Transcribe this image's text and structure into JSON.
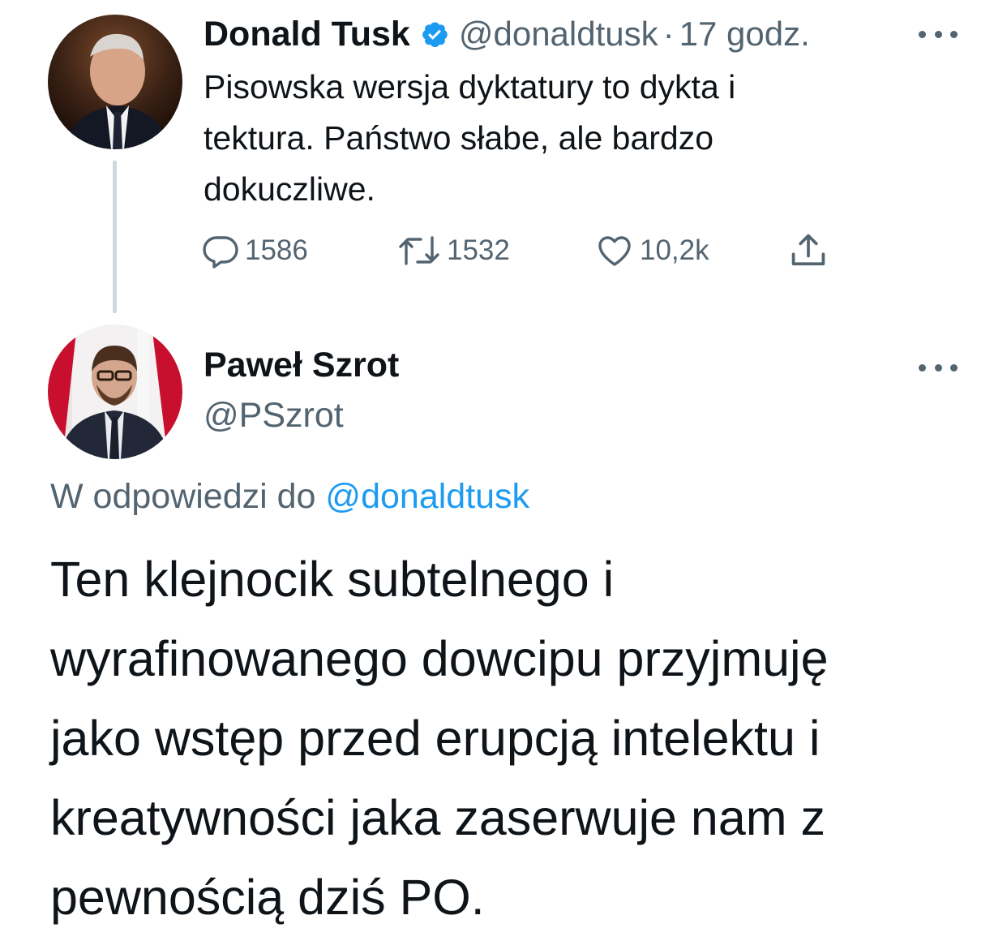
{
  "tweet1": {
    "author_name": "Donald Tusk",
    "handle": "@donaldtusk",
    "separator": "·",
    "time": "17 godz.",
    "verified": true,
    "text_lines": [
      "Pisowska wersja dyktatury to dykta i",
      "tektura. Państwo słabe, ale bardzo",
      "dokuczliwe."
    ],
    "actions": {
      "replies": "1586",
      "retweets": "1532",
      "likes": "10,2k"
    },
    "icons": {
      "verified": "verified-badge-icon",
      "reply": "reply-bubble-icon",
      "retweet": "retweet-icon",
      "like": "heart-icon",
      "share": "share-icon",
      "more": "more-dots-icon"
    }
  },
  "tweet2": {
    "author_name": "Paweł Szrot",
    "handle": "@PSzrot",
    "reply_prefix": "W odpowiedzi do",
    "reply_to": "@donaldtusk",
    "text_lines": [
      "Ten klejnocik subtelnego i",
      "wyrafinowanego dowcipu przyjmuję",
      "jako wstęp przed erupcją intelektu i",
      "kreatywności jaka zaserwuje nam z",
      "pewnością dziś PO."
    ]
  },
  "colors": {
    "text_primary": "#0f1419",
    "text_secondary": "#536471",
    "accent_blue": "#1d9bf0",
    "thread_line": "#cfd9de"
  }
}
